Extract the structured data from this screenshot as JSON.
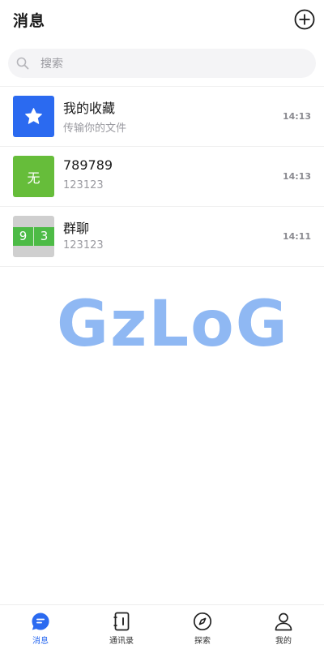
{
  "header": {
    "title": "消息",
    "add_icon": "plus-circle-icon"
  },
  "search": {
    "placeholder": "搜索",
    "value": "",
    "icon": "search-icon"
  },
  "conversations": [
    {
      "name": "我的收藏",
      "preview": "传输你的文件",
      "time": "14:13",
      "avatar": {
        "type": "icon",
        "icon": "star-icon",
        "color": "#2b6af0"
      }
    },
    {
      "name": "789789",
      "preview": "123123",
      "time": "14:13",
      "avatar": {
        "type": "text",
        "text": "无",
        "color": "#66bd3a"
      }
    },
    {
      "name": "群聊",
      "preview": "123123",
      "time": "14:11",
      "avatar": {
        "type": "group",
        "cells": [
          "9",
          "3"
        ],
        "color": "#4dbb46"
      }
    }
  ],
  "watermark": {
    "text": "GzLoG",
    "color": "#8ab5f3"
  },
  "tabbar": {
    "accent": "#2b6af0",
    "items": [
      {
        "label": "消息",
        "icon": "chat-bubble-icon",
        "active": true
      },
      {
        "label": "通讯录",
        "icon": "contacts-book-icon",
        "active": false
      },
      {
        "label": "探索",
        "icon": "compass-icon",
        "active": false
      },
      {
        "label": "我的",
        "icon": "user-icon",
        "active": false
      }
    ]
  }
}
